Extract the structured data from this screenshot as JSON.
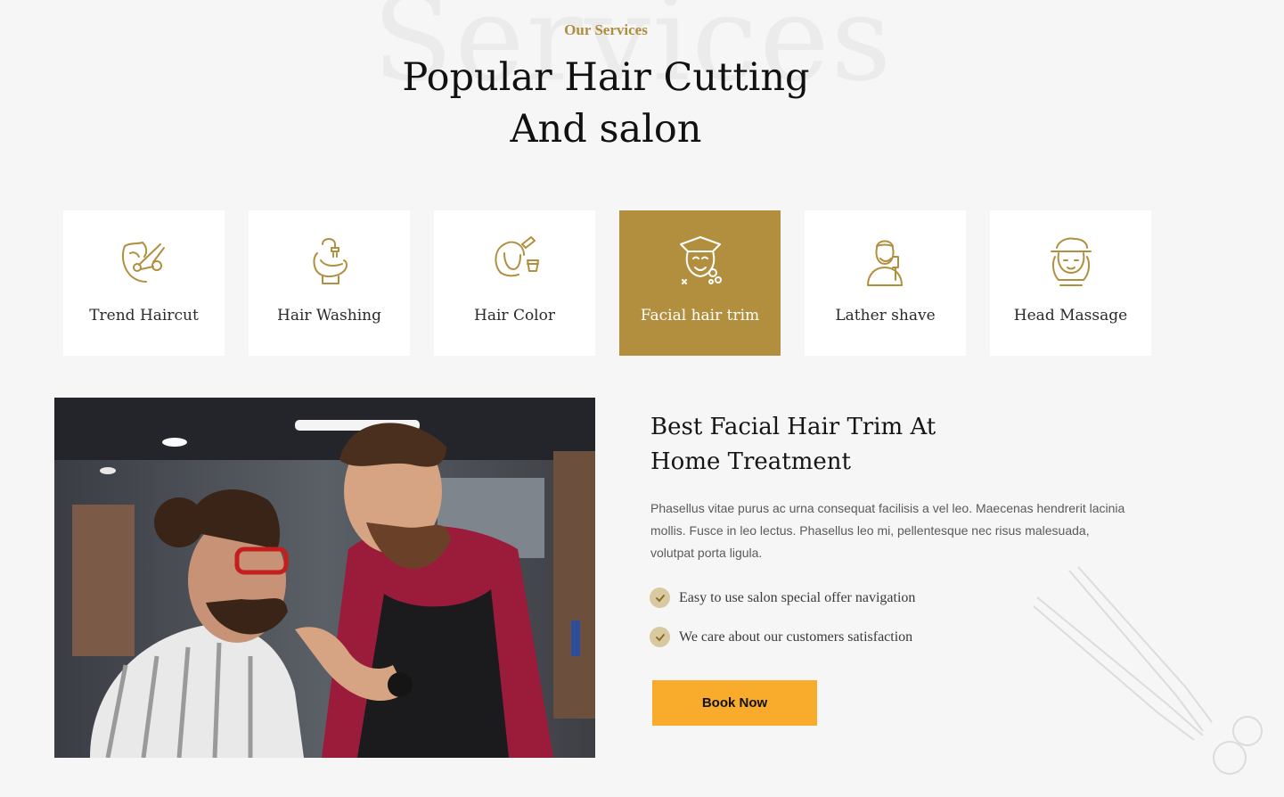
{
  "section": {
    "background_word": "Services",
    "eyebrow": "Our Services",
    "headline_line1": "Popular Hair Cutting",
    "headline_line2": "And salon"
  },
  "services": [
    {
      "label": "Trend Haircut",
      "icon": "haircut-scissors-icon",
      "active": false
    },
    {
      "label": "Hair Washing",
      "icon": "hair-washing-icon",
      "active": false
    },
    {
      "label": "Hair Color",
      "icon": "hair-color-icon",
      "active": false
    },
    {
      "label": "Facial hair trim",
      "icon": "facial-treatment-icon",
      "active": true
    },
    {
      "label": "Lather shave",
      "icon": "lather-shave-icon",
      "active": false
    },
    {
      "label": "Head Massage",
      "icon": "head-massage-icon",
      "active": false
    }
  ],
  "detail": {
    "title_line1": "Best Facial Hair Trim At",
    "title_line2": "Home Treatment",
    "body": "Phasellus vitae purus ac urna consequat facilisis a vel leo. Maecenas hendrerit lacinia mollis. Fusce in leo lectus. Phasellus leo mi, pellentesque nec risus malesuada, volutpat porta ligula.",
    "features": [
      "Easy to use salon special offer navigation",
      "We care about our customers satisfaction"
    ],
    "button_label": "Book Now"
  },
  "colors": {
    "accent_gold": "#b28f3e",
    "button_yellow": "#f9ac2c",
    "check_bg": "#d9c9a1",
    "page_bg": "#f6f6f6"
  }
}
